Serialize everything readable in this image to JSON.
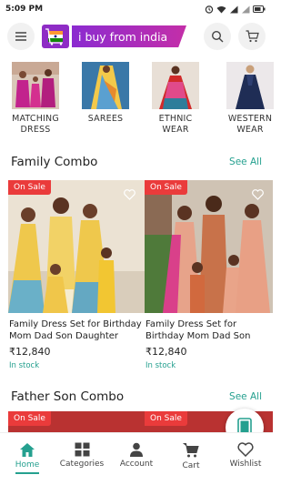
{
  "status_bar": {
    "time": "5:09 PM"
  },
  "header": {
    "brand_text": "i buy from india"
  },
  "categories": [
    {
      "label": "MATCHING DRESS"
    },
    {
      "label": "SAREES"
    },
    {
      "label": "ETHNIC WEAR"
    },
    {
      "label": "WESTERN WEAR"
    }
  ],
  "sections": [
    {
      "title": "Family Combo",
      "see_all": "See All",
      "products": [
        {
          "badge": "On Sale",
          "title": "Family Dress Set for Birthday Mom Dad Son Daughter Dress",
          "price": "₹12,840",
          "stock": "In stock"
        },
        {
          "badge": "On Sale",
          "title": "Family Dress Set for Birthday Mom Dad Son Daughter Dress",
          "price": "₹12,840",
          "stock": "In stock"
        }
      ]
    },
    {
      "title": "Father Son Combo",
      "see_all": "See All",
      "products": [
        {
          "badge": "On Sale"
        },
        {
          "badge": "On Sale"
        }
      ]
    }
  ],
  "bottom_nav": [
    {
      "label": "Home",
      "icon": "home-icon",
      "active": true
    },
    {
      "label": "Categories",
      "icon": "grid-icon"
    },
    {
      "label": "Account",
      "icon": "person-icon"
    },
    {
      "label": "Cart",
      "icon": "cart-icon"
    },
    {
      "label": "Wishlist",
      "icon": "heart-icon"
    }
  ],
  "colors": {
    "accent": "#25a08f",
    "sale_badge": "#ea3b3b",
    "brand": "#8b2bd0"
  }
}
